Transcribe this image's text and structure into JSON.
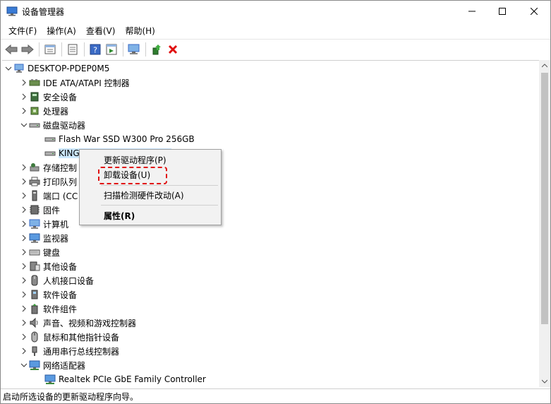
{
  "window": {
    "title": "设备管理器",
    "minimize": "—",
    "maximize": "☐",
    "close": "✕"
  },
  "menu": [
    "文件(F)",
    "操作(A)",
    "查看(V)",
    "帮助(H)"
  ],
  "toolbar": {
    "buttons": [
      "back-icon",
      "forward-icon",
      "view-icon",
      "properties-icon",
      "help-icon",
      "run-icon",
      "monitor-scan-icon",
      "update-driver-icon",
      "uninstall-icon"
    ],
    "uninstall_color": "#e01010"
  },
  "tree": {
    "root": "DESKTOP-PDEP0M5",
    "items": [
      {
        "label": "IDE ATA/ATAPI 控制器",
        "expanded": false
      },
      {
        "label": "安全设备",
        "expanded": false
      },
      {
        "label": "处理器",
        "expanded": false
      },
      {
        "label": "磁盘驱动器",
        "expanded": true
      },
      {
        "label": "Flash War SSD W300 Pro 256GB",
        "child": true
      },
      {
        "label": "KING",
        "child": true,
        "selected": true
      },
      {
        "label": "存储控制",
        "expanded": false
      },
      {
        "label": "打印队列",
        "expanded": false
      },
      {
        "label": "端口 (CC",
        "expanded": false
      },
      {
        "label": "固件",
        "expanded": false
      },
      {
        "label": "计算机",
        "expanded": false
      },
      {
        "label": "监视器",
        "expanded": false
      },
      {
        "label": "键盘",
        "expanded": false
      },
      {
        "label": "其他设备",
        "expanded": false
      },
      {
        "label": "人机接口设备",
        "expanded": false
      },
      {
        "label": "软件设备",
        "expanded": false
      },
      {
        "label": "软件组件",
        "expanded": false
      },
      {
        "label": "声音、视频和游戏控制器",
        "expanded": false
      },
      {
        "label": "鼠标和其他指针设备",
        "expanded": false
      },
      {
        "label": "通用串行总线控制器",
        "expanded": false
      },
      {
        "label": "网络适配器",
        "expanded": true
      },
      {
        "label": "Realtek PCIe GbE Family Controller",
        "child": true
      }
    ]
  },
  "context_menu": {
    "items": [
      "更新驱动程序(P)",
      "卸载设备(U)",
      "扫描检测硬件改动(A)",
      "属性(R)"
    ]
  },
  "status": "启动所选设备的更新驱动程序向导。"
}
